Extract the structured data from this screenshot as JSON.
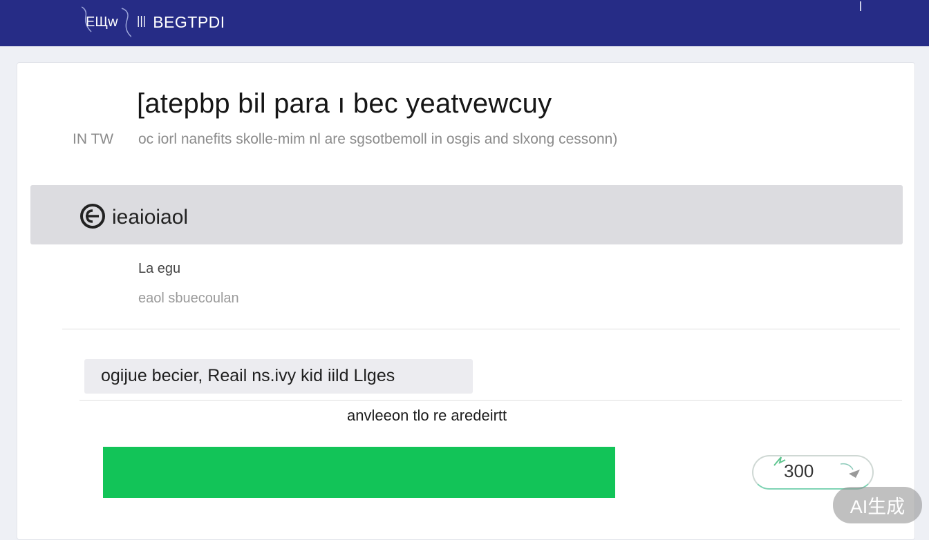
{
  "header": {
    "logo_text": "ЕЩw",
    "glyph": "ꔖ",
    "brand_name": "BEGTPDI"
  },
  "main": {
    "title": "[atepbp bil para ı bec yeatvewcuy",
    "meta_tag": "IN TW",
    "subtitle": "oc iorl nanefits skolle-mim nl are sgsotbemoll in osgis and slxong cessonn)"
  },
  "section": {
    "label": "ieaioiaol"
  },
  "field": {
    "label": "La egu",
    "value": "eaol sbuecoulan"
  },
  "chip": {
    "text": "ogijue becier, Reail ns.ivy kid iild Llges"
  },
  "progress": {
    "caption": "anvleeon tlo re aredeirtt",
    "value_percent": 100,
    "color": "#12c458",
    "counter_value": "300"
  },
  "watermark": {
    "text": "AI生成"
  }
}
